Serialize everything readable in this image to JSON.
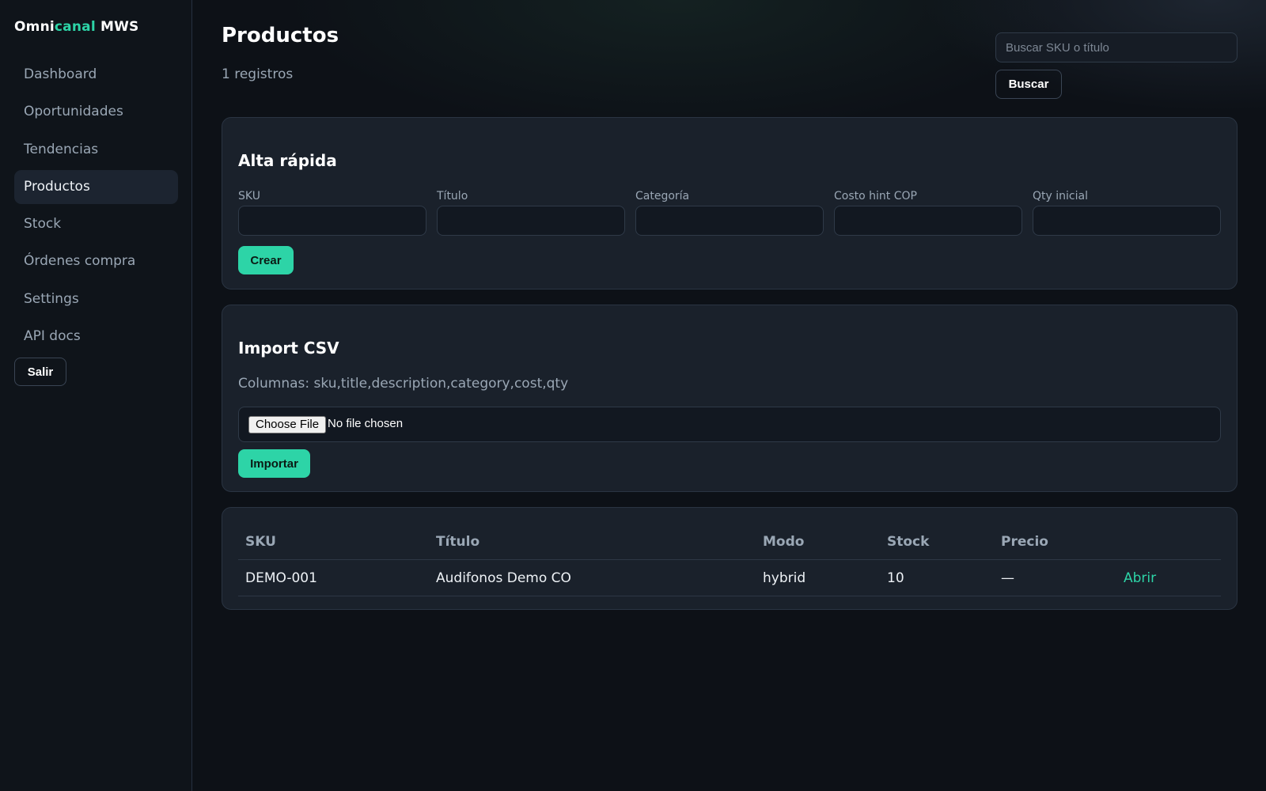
{
  "brand": {
    "part1": "Omni",
    "part2": "canal",
    "part3": " MWS"
  },
  "sidebar": {
    "items": [
      {
        "label": "Dashboard"
      },
      {
        "label": "Oportunidades"
      },
      {
        "label": "Tendencias"
      },
      {
        "label": "Productos",
        "active": true
      },
      {
        "label": "Stock"
      },
      {
        "label": "Órdenes compra"
      },
      {
        "label": "Settings"
      },
      {
        "label": "API docs"
      }
    ],
    "logout_label": "Salir"
  },
  "header": {
    "title": "Productos",
    "subtitle": "1 registros",
    "search_placeholder": "Buscar SKU o título",
    "search_value": "",
    "search_button": "Buscar"
  },
  "quick_create": {
    "title": "Alta rápida",
    "fields": [
      {
        "label": "SKU",
        "value": ""
      },
      {
        "label": "Título",
        "value": ""
      },
      {
        "label": "Categoría",
        "value": ""
      },
      {
        "label": "Costo hint COP",
        "value": ""
      },
      {
        "label": "Qty inicial",
        "value": ""
      }
    ],
    "submit_label": "Crear"
  },
  "import_csv": {
    "title": "Import CSV",
    "description": "Columnas: sku,title,description,category,cost,qty",
    "file_button": "Choose File",
    "file_status": "No file chosen",
    "submit_label": "Importar"
  },
  "table": {
    "headers": [
      "SKU",
      "Título",
      "Modo",
      "Stock",
      "Precio"
    ],
    "rows": [
      {
        "sku": "DEMO-001",
        "title": "Audifonos Demo CO",
        "mode": "hybrid",
        "stock": "10",
        "price": "—",
        "action": "Abrir"
      }
    ]
  },
  "colors": {
    "accent": "#2dd4a7",
    "background": "#0d1117",
    "sidebar_bg": "#0f141a",
    "card_bg": "#1a212b",
    "muted_text": "#9aa7b5"
  }
}
